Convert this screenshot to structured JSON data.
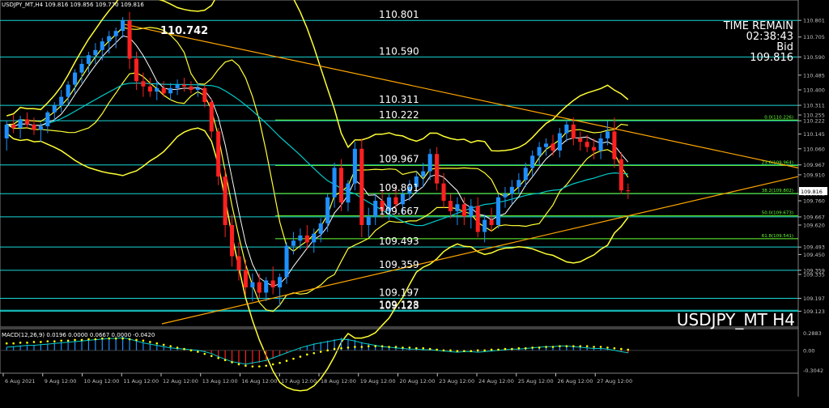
{
  "chart_data": {
    "type": "candlestick",
    "header": "USDJPY_MT,H4  109.816 109.856 109.770 109.816",
    "symbol_label": "USDJPY_MT H4",
    "info": {
      "line1": "TIME REMAIN",
      "line2": "02:38:43",
      "line3": "Bid",
      "line4": "109.816"
    },
    "colors": {
      "up": "#1e90ff",
      "down": "#ff2020",
      "level": "#19d6d6",
      "bollinger": "#ffff33",
      "trend": "#ffa500",
      "fib": "#66ff33",
      "ma": "#00cccc",
      "axis": "#c0c0c0"
    },
    "ylim": [
      109.05,
      110.9
    ],
    "yticks": [
      "110.801",
      "110.705",
      "110.590",
      "110.485",
      "110.400",
      "110.311",
      "110.255",
      "110.222",
      "110.145",
      "110.060",
      "109.967",
      "109.910",
      "109.801",
      "109.760",
      "109.667",
      "109.620",
      "109.493",
      "109.450",
      "109.359",
      "109.335",
      "109.197",
      "109.123"
    ],
    "price_labels": [
      {
        "price": 110.801,
        "text": "110.801"
      },
      {
        "price": 110.59,
        "text": "110.590"
      },
      {
        "price": 110.311,
        "text": "110.311"
      },
      {
        "price": 110.222,
        "text": "110.222"
      },
      {
        "price": 109.967,
        "text": "109.967"
      },
      {
        "price": 109.801,
        "text": "109.801"
      },
      {
        "price": 109.667,
        "text": "109.667"
      },
      {
        "price": 109.493,
        "text": "109.493"
      },
      {
        "price": 109.359,
        "text": "109.359"
      },
      {
        "price": 109.197,
        "text": "109.197"
      },
      {
        "price": 109.128,
        "text": "109.128"
      },
      {
        "price": 109.123,
        "text": "109.123"
      }
    ],
    "highlight_label": {
      "price": 110.742,
      "text": "110.742"
    },
    "fib_labels": [
      {
        "price": 110.226,
        "text": "0.0(110.226)"
      },
      {
        "price": 109.964,
        "text": "23.6(109.964)"
      },
      {
        "price": 109.802,
        "text": "38.2(109.802)"
      },
      {
        "price": 109.673,
        "text": "50.0(109.673)"
      },
      {
        "price": 109.541,
        "text": "61.8(109.541)"
      }
    ],
    "xlabels": [
      "6 Aug 2021",
      "9 Aug 12:00",
      "10 Aug 12:00",
      "11 Aug 12:00",
      "12 Aug 12:00",
      "13 Aug 12:00",
      "16 Aug 12:00",
      "17 Aug 12:00",
      "18 Aug 12:00",
      "19 Aug 12:00",
      "20 Aug 12:00",
      "23 Aug 12:00",
      "24 Aug 12:00",
      "25 Aug 12:00",
      "26 Aug 12:00",
      "27 Aug 12:00"
    ],
    "candles": [
      [
        110.12,
        110.22,
        110.05,
        110.2
      ],
      [
        110.2,
        110.26,
        110.15,
        110.18
      ],
      [
        110.18,
        110.25,
        110.12,
        110.23
      ],
      [
        110.23,
        110.27,
        110.18,
        110.2
      ],
      [
        110.2,
        110.24,
        110.14,
        110.17
      ],
      [
        110.17,
        110.21,
        110.1,
        110.19
      ],
      [
        110.19,
        110.28,
        110.15,
        110.27
      ],
      [
        110.27,
        110.33,
        110.22,
        110.31
      ],
      [
        110.31,
        110.4,
        110.27,
        110.36
      ],
      [
        110.36,
        110.45,
        110.32,
        110.43
      ],
      [
        110.43,
        110.52,
        110.38,
        110.5
      ],
      [
        110.5,
        110.58,
        110.44,
        110.55
      ],
      [
        110.55,
        110.62,
        110.5,
        110.6
      ],
      [
        110.6,
        110.67,
        110.55,
        110.63
      ],
      [
        110.63,
        110.7,
        110.57,
        110.68
      ],
      [
        110.68,
        110.74,
        110.61,
        110.71
      ],
      [
        110.71,
        110.76,
        110.64,
        110.74
      ],
      [
        110.74,
        110.82,
        110.7,
        110.8
      ],
      [
        110.8,
        110.85,
        110.52,
        110.58
      ],
      [
        110.58,
        110.62,
        110.4,
        110.45
      ],
      [
        110.45,
        110.5,
        110.36,
        110.42
      ],
      [
        110.42,
        110.47,
        110.36,
        110.39
      ],
      [
        110.39,
        110.45,
        110.34,
        110.41
      ],
      [
        110.41,
        110.45,
        110.36,
        110.38
      ],
      [
        110.38,
        110.44,
        110.34,
        110.41
      ],
      [
        110.41,
        110.46,
        110.37,
        110.43
      ],
      [
        110.43,
        110.47,
        110.39,
        110.42
      ],
      [
        110.42,
        110.45,
        110.38,
        110.4
      ],
      [
        110.4,
        110.44,
        110.36,
        110.41
      ],
      [
        110.41,
        110.43,
        110.3,
        110.33
      ],
      [
        110.33,
        110.35,
        110.12,
        110.16
      ],
      [
        110.16,
        110.18,
        109.85,
        109.9
      ],
      [
        109.9,
        109.95,
        109.55,
        109.62
      ],
      [
        109.62,
        109.68,
        109.38,
        109.44
      ],
      [
        109.44,
        109.52,
        109.3,
        109.36
      ],
      [
        109.36,
        109.42,
        109.22,
        109.26
      ],
      [
        109.26,
        109.34,
        109.18,
        109.29
      ],
      [
        109.29,
        109.34,
        109.2,
        109.23
      ],
      [
        109.23,
        109.32,
        109.18,
        109.3
      ],
      [
        109.3,
        109.38,
        109.22,
        109.26
      ],
      [
        109.26,
        109.34,
        109.15,
        109.32
      ],
      [
        109.32,
        109.52,
        109.28,
        109.5
      ],
      [
        109.5,
        109.58,
        109.45,
        109.53
      ],
      [
        109.53,
        109.6,
        109.48,
        109.56
      ],
      [
        109.56,
        109.62,
        109.48,
        109.52
      ],
      [
        109.52,
        109.6,
        109.46,
        109.57
      ],
      [
        109.57,
        109.66,
        109.52,
        109.63
      ],
      [
        109.63,
        109.8,
        109.58,
        109.78
      ],
      [
        109.78,
        109.98,
        109.72,
        109.95
      ],
      [
        109.95,
        110.0,
        109.7,
        109.75
      ],
      [
        109.75,
        109.88,
        109.7,
        109.86
      ],
      [
        109.86,
        110.1,
        109.82,
        110.06
      ],
      [
        110.06,
        110.12,
        109.55,
        109.62
      ],
      [
        109.62,
        109.72,
        109.55,
        109.67
      ],
      [
        109.67,
        109.8,
        109.62,
        109.76
      ],
      [
        109.76,
        109.82,
        109.66,
        109.7
      ],
      [
        109.7,
        109.8,
        109.65,
        109.78
      ],
      [
        109.78,
        109.85,
        109.7,
        109.74
      ],
      [
        109.74,
        109.82,
        109.68,
        109.8
      ],
      [
        109.8,
        109.88,
        109.76,
        109.84
      ],
      [
        109.84,
        109.93,
        109.8,
        109.9
      ],
      [
        109.9,
        109.98,
        109.84,
        109.93
      ],
      [
        109.93,
        110.06,
        109.88,
        110.03
      ],
      [
        110.03,
        110.07,
        109.82,
        109.86
      ],
      [
        109.86,
        109.92,
        109.72,
        109.76
      ],
      [
        109.76,
        109.8,
        109.66,
        109.7
      ],
      [
        109.7,
        109.78,
        109.62,
        109.74
      ],
      [
        109.74,
        109.78,
        109.62,
        109.67
      ],
      [
        109.67,
        109.77,
        109.6,
        109.73
      ],
      [
        109.73,
        109.78,
        109.55,
        109.58
      ],
      [
        109.58,
        109.68,
        109.52,
        109.65
      ],
      [
        109.65,
        109.72,
        109.58,
        109.62
      ],
      [
        109.62,
        109.8,
        109.6,
        109.78
      ],
      [
        109.78,
        109.84,
        109.72,
        109.8
      ],
      [
        109.8,
        109.88,
        109.74,
        109.84
      ],
      [
        109.84,
        109.92,
        109.8,
        109.88
      ],
      [
        109.88,
        109.98,
        109.84,
        109.95
      ],
      [
        109.95,
        110.05,
        109.9,
        110.02
      ],
      [
        110.02,
        110.1,
        109.97,
        110.07
      ],
      [
        110.07,
        110.12,
        110.02,
        110.09
      ],
      [
        110.09,
        110.14,
        110.02,
        110.05
      ],
      [
        110.05,
        110.18,
        110.01,
        110.15
      ],
      [
        110.15,
        110.23,
        110.1,
        110.2
      ],
      [
        110.2,
        110.24,
        110.08,
        110.12
      ],
      [
        110.12,
        110.16,
        110.05,
        110.1
      ],
      [
        110.1,
        110.14,
        110.04,
        110.07
      ],
      [
        110.07,
        110.12,
        110.0,
        110.05
      ],
      [
        110.05,
        110.15,
        110.0,
        110.12
      ],
      [
        110.12,
        110.22,
        110.08,
        110.16
      ],
      [
        110.16,
        110.24,
        109.95,
        110.0
      ],
      [
        110.0,
        110.04,
        109.8,
        109.82
      ],
      [
        109.82,
        109.86,
        109.77,
        109.816
      ]
    ],
    "macd": {
      "label": "MACD(12,26,9) 0.0196 0.0000 0.0667 0.0000 -0.0420",
      "ylim": [
        -0.3042,
        0.2883
      ],
      "yticks": [
        "0.2883",
        "0.00",
        "-0.3042"
      ],
      "hist": [
        0.05,
        0.06,
        0.07,
        0.08,
        0.08,
        0.09,
        0.1,
        0.11,
        0.12,
        0.13,
        0.14,
        0.15,
        0.16,
        0.17,
        0.18,
        0.19,
        0.19,
        0.2,
        0.18,
        0.15,
        0.12,
        0.1,
        0.08,
        0.06,
        0.04,
        0.03,
        0.02,
        0.01,
        0.0,
        -0.02,
        -0.05,
        -0.1,
        -0.14,
        -0.18,
        -0.2,
        -0.22,
        -0.2,
        -0.18,
        -0.16,
        -0.12,
        -0.08,
        -0.04,
        0.0,
        0.04,
        0.07,
        0.1,
        0.12,
        0.14,
        0.16,
        0.18,
        0.17,
        0.15,
        0.12,
        0.1,
        0.08,
        0.06,
        0.05,
        0.04,
        0.03,
        0.02,
        0.02,
        0.01,
        0.01,
        0.0,
        -0.01,
        -0.02,
        -0.03,
        -0.02,
        -0.02,
        -0.03,
        -0.02,
        -0.01,
        0.0,
        0.01,
        0.02,
        0.02,
        0.03,
        0.04,
        0.05,
        0.06,
        0.06,
        0.07,
        0.07,
        0.06,
        0.05,
        0.04,
        0.03,
        0.03,
        0.02,
        0.0,
        -0.02,
        -0.04
      ],
      "signal": [
        0.1,
        0.1,
        0.11,
        0.11,
        0.12,
        0.12,
        0.13,
        0.13,
        0.14,
        0.14,
        0.15,
        0.15,
        0.16,
        0.16,
        0.17,
        0.17,
        0.17,
        0.17,
        0.16,
        0.15,
        0.14,
        0.12,
        0.1,
        0.08,
        0.06,
        0.04,
        0.02,
        0.0,
        -0.02,
        -0.05,
        -0.08,
        -0.11,
        -0.14,
        -0.17,
        -0.2,
        -0.22,
        -0.23,
        -0.23,
        -0.22,
        -0.2,
        -0.18,
        -0.15,
        -0.12,
        -0.09,
        -0.06,
        -0.04,
        -0.02,
        0.0,
        0.02,
        0.03,
        0.04,
        0.05,
        0.05,
        0.06,
        0.06,
        0.06,
        0.05,
        0.05,
        0.04,
        0.04,
        0.03,
        0.03,
        0.02,
        0.01,
        0.0,
        0.0,
        -0.01,
        -0.01,
        -0.01,
        0.0,
        0.0,
        0.01,
        0.01,
        0.02,
        0.02,
        0.03,
        0.03,
        0.04,
        0.04,
        0.05,
        0.05,
        0.06,
        0.06,
        0.06,
        0.06,
        0.06,
        0.05,
        0.05,
        0.04,
        0.03,
        0.02,
        0.01
      ]
    }
  }
}
